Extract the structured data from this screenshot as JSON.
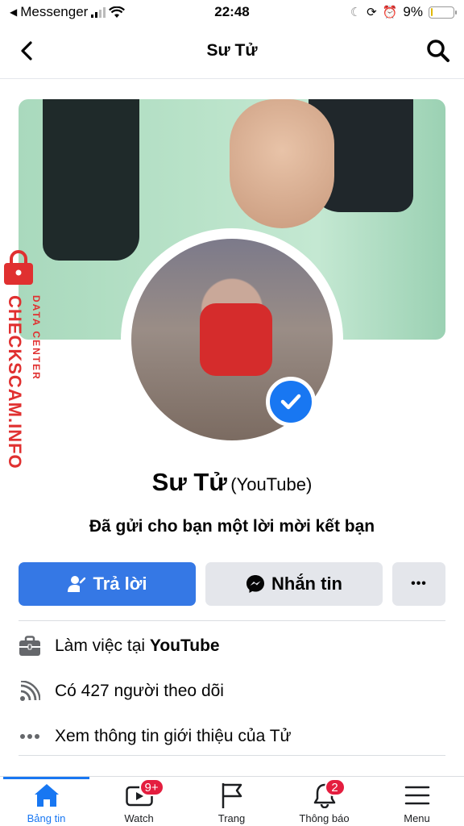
{
  "status_bar": {
    "back_app": "Messenger",
    "time": "22:48",
    "battery_percent": "9%",
    "battery_level": 0.09
  },
  "header": {
    "title": "Sư Tử"
  },
  "watermark": {
    "brand": "CHECKSCAM.INFO",
    "sub": "DATA CENTER"
  },
  "profile": {
    "name": "Sư Tử",
    "name_suffix": "(YouTube)",
    "request_text": "Đã gửi cho bạn một lời mời kết bạn"
  },
  "actions": {
    "reply_label": "Trả lời",
    "message_label": "Nhắn tin",
    "more_label": "•••"
  },
  "info": {
    "work_prefix": "Làm việc tại",
    "work_place": "YouTube",
    "followers": "Có 427 người theo dõi",
    "about": "Xem thông tin giới thiệu của Tử"
  },
  "bottom_nav": {
    "tabs": [
      {
        "label": "Bảng tin",
        "icon": "home-icon",
        "active": true
      },
      {
        "label": "Watch",
        "icon": "watch-icon",
        "badge": "9+"
      },
      {
        "label": "Trang",
        "icon": "flag-icon"
      },
      {
        "label": "Thông báo",
        "icon": "bell-icon",
        "badge": "2"
      },
      {
        "label": "Menu",
        "icon": "menu-icon"
      }
    ]
  },
  "colors": {
    "accent": "#1877f2",
    "button_primary": "#3578e5",
    "button_secondary": "#e4e6eb",
    "badge": "#e41e3f",
    "watermark": "#e03030"
  }
}
